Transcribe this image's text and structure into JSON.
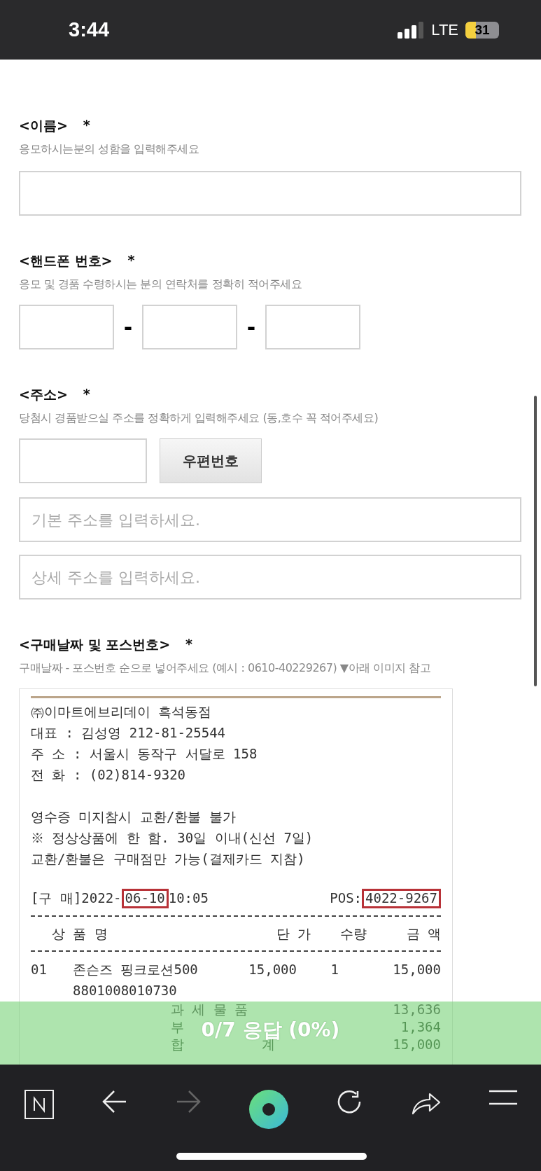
{
  "status_bar": {
    "time": "3:44",
    "network": "LTE",
    "battery": {
      "text": "31",
      "level": 0.31
    }
  },
  "form": {
    "name": {
      "label": "<이름>",
      "required": "*",
      "help": "응모하시는분의 성함을 입력해주세요"
    },
    "phone": {
      "label": "<핸드폰 번호>",
      "required": "*",
      "help": "응모 및 경품 수령하시는 분의 연락처를 정확히 적어주세요",
      "separators": [
        "-",
        "-"
      ]
    },
    "address": {
      "label": "<주소>",
      "required": "*",
      "help": "당첨시 경품받으실 주소를 정확하게 입력해주세요 (동,호수 꼭 적어주세요)",
      "zip_button": "우편번호",
      "base_placeholder": "기본 주소를 입력하세요.",
      "detail_placeholder": "상세 주소를 입력하세요."
    },
    "purchase": {
      "label": "<구매날짜 및 포스번호>",
      "required": "*",
      "help": "구매날짜 - 포스번호 순으로 넣어주세요 (예시 : 0610-40229267) ▼아래 이미지 참고"
    }
  },
  "receipt": {
    "header_lines": [
      "㈜이마트에브리데이 흑석동점",
      "대표 : 김성영 212-81-25544",
      "주 소 : 서울시 동작구 서달로 158",
      "전 화 : (02)814-9320"
    ],
    "notice_lines": [
      "영수증 미지참시 교환/환불 불가",
      "※ 정상상품에 한 함. 30일 이내(신선 7일)",
      "교환/환불은 구매점만 가능(결제카드 지참)"
    ],
    "purchase_line": {
      "prefix": "[구 매]2022-",
      "date": "06-10",
      "time": "10:05",
      "pos_label": "POS:",
      "pos": "4022-9267"
    },
    "columns": [
      "상 품 명",
      "단 가",
      "수량",
      "금 액"
    ],
    "items": [
      {
        "no": "01",
        "name": "존슨즈 핑크로션500",
        "price": "15,000",
        "qty": "1",
        "amount": "15,000",
        "barcode": "8801008010730"
      }
    ],
    "totals": [
      {
        "label": "과 세 물 품",
        "value": "13,636"
      },
      {
        "label": "부",
        "value": "1,364"
      },
      {
        "label": "합",
        "label_end": "계",
        "value": "15,000"
      }
    ]
  },
  "progress_banner": "0/7 응답 (0%)",
  "toolbar": [
    {
      "kind": "home",
      "disabled": false
    },
    {
      "kind": "back",
      "disabled": false
    },
    {
      "kind": "forward",
      "disabled": true
    },
    {
      "kind": "center",
      "disabled": false
    },
    {
      "kind": "reload",
      "disabled": false
    },
    {
      "kind": "share",
      "disabled": false
    },
    {
      "kind": "menu",
      "disabled": false
    }
  ]
}
